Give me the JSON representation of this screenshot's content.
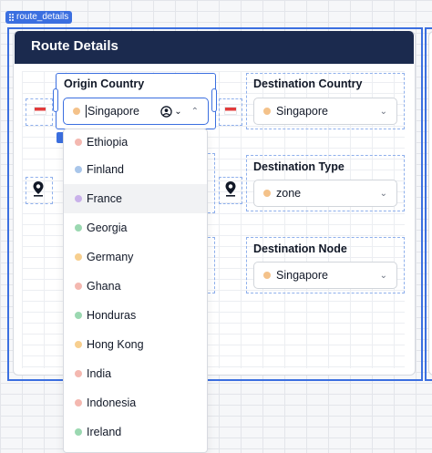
{
  "selection_tag": "route_details",
  "card": {
    "title": "Route Details"
  },
  "origin": {
    "label": "Origin Country",
    "value": "Singapore",
    "dot_color": "#f4c28a",
    "options": [
      {
        "label": "Ethiopia",
        "color": "#f4b8b0"
      },
      {
        "label": "Finland",
        "color": "#a9c6ea"
      },
      {
        "label": "France",
        "color": "#c9b1ea",
        "highlighted": true
      },
      {
        "label": "Georgia",
        "color": "#9bd8b1"
      },
      {
        "label": "Germany",
        "color": "#f7cf8f"
      },
      {
        "label": "Ghana",
        "color": "#f4b8b0"
      },
      {
        "label": "Honduras",
        "color": "#9bd8b1"
      },
      {
        "label": "Hong Kong",
        "color": "#f7cf8f"
      },
      {
        "label": "India",
        "color": "#f4b8b0"
      },
      {
        "label": "Indonesia",
        "color": "#f4b8b0"
      },
      {
        "label": "Ireland",
        "color": "#9bd8b1"
      }
    ]
  },
  "destination_country": {
    "label": "Destination Country",
    "value": "Singapore",
    "dot_color": "#f4c28a"
  },
  "destination_type": {
    "label": "Destination Type",
    "value": "zone",
    "dot_color": "#f4c28a"
  },
  "destination_node": {
    "label": "Destination Node",
    "value": "Singapore",
    "dot_color": "#f4c28a"
  },
  "colors": {
    "accent": "#3b6fe0",
    "header_bg": "#1b2a4e"
  }
}
